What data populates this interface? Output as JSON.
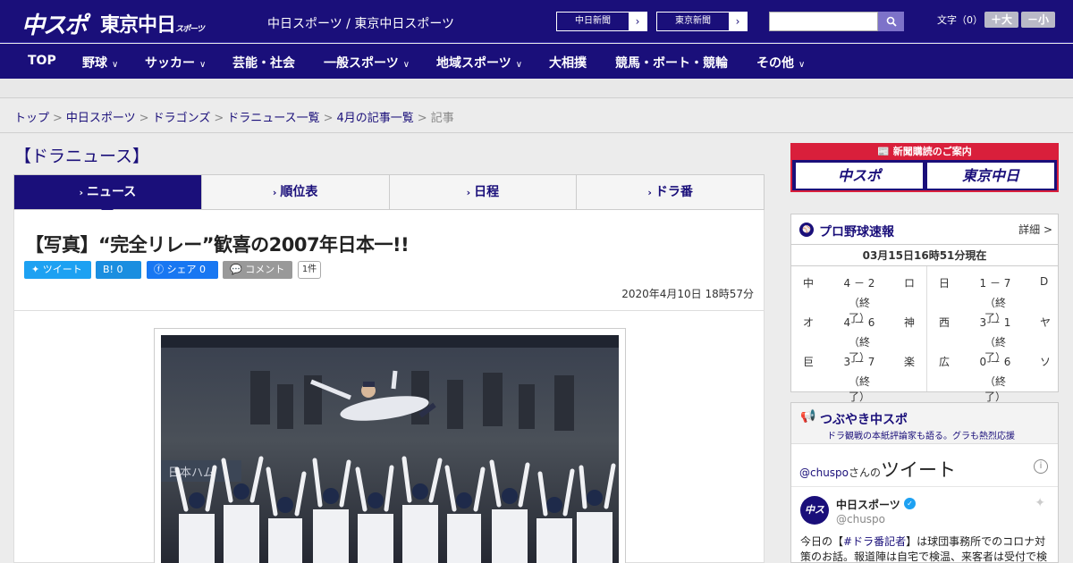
{
  "header": {
    "logo_chuspo": "中スポ",
    "logo_tokyo": "東京中日",
    "logo_tokyo_small": "スポーツ",
    "site_names": "中日スポーツ / 東京中日スポーツ",
    "ext_link_1": "中日新聞",
    "ext_link_2": "東京新聞",
    "search_placeholder": "",
    "fontsize_label": "文字（0）",
    "font_increase": "＋大",
    "font_decrease": "－小"
  },
  "nav": {
    "items": [
      {
        "label": "TOP",
        "has_menu": false
      },
      {
        "label": "野球",
        "has_menu": true
      },
      {
        "label": "サッカー",
        "has_menu": true
      },
      {
        "label": "芸能・社会",
        "has_menu": false
      },
      {
        "label": "一般スポーツ",
        "has_menu": true
      },
      {
        "label": "地域スポーツ",
        "has_menu": true
      },
      {
        "label": "大相撲",
        "has_menu": false
      },
      {
        "label": "競馬・ボート・競輪",
        "has_menu": false
      },
      {
        "label": "その他",
        "has_menu": true
      }
    ]
  },
  "breadcrumb": {
    "items": [
      "トップ",
      "中日スポーツ",
      "ドラゴンズ",
      "ドラニュース一覧",
      "4月の記事一覧"
    ],
    "current": "記事"
  },
  "section_title": "【ドラニュース】",
  "tabs": [
    {
      "label": "ニュース",
      "active": true
    },
    {
      "label": "順位表",
      "active": false
    },
    {
      "label": "日程",
      "active": false
    },
    {
      "label": "ドラ番",
      "active": false
    }
  ],
  "article": {
    "headline": "【写真】“完全リレー”歓喜の2007年日本一!!",
    "share": {
      "tweet": "ツイート",
      "hatena": "B! 0",
      "facebook": "シェア 0",
      "comment": "コメント",
      "count": "1件"
    },
    "date": "2020年4月10日 18時57分",
    "photo_sign": "日本ハム"
  },
  "sidebar": {
    "subscription": {
      "heading": "新聞購読のご案内",
      "logo_1": "中スポ",
      "logo_2": "東京中日"
    },
    "baseball": {
      "title": "プロ野球速報",
      "detail": "詳細 >",
      "timestamp": "03月15日16時51分現在",
      "games": [
        {
          "team1": "中",
          "score": "4 － 2",
          "team2": "ロ",
          "status": "（終了）"
        },
        {
          "team1": "日",
          "score": "1 － 7",
          "team2": "D",
          "status": "（終了）"
        },
        {
          "team1": "オ",
          "score": "4 － 6",
          "team2": "神",
          "status": "（終了）"
        },
        {
          "team1": "西",
          "score": "3 － 1",
          "team2": "ヤ",
          "status": "（終了）"
        },
        {
          "team1": "巨",
          "score": "3 － 7",
          "team2": "楽",
          "status": "（終了）"
        },
        {
          "team1": "広",
          "score": "0 － 6",
          "team2": "ソ",
          "status": "（終了）"
        }
      ]
    },
    "tweets": {
      "title": "つぶやき中スポ",
      "subtitle": "ドラ観戦の本紙評論家も語る。グラも熱烈応援",
      "handle": "@chuspo",
      "san_no": "さんの",
      "tweet_word": "ツイート",
      "account_name": "中日スポーツ",
      "account_handle": "@chuspo",
      "avatar_text": "中スポ",
      "text_pre": "今日の【",
      "text_tag": "#ドラ番記者",
      "text_post": "】は球団事務所でのコロナ対策のお話。報道陣は自宅で検温、来客者は受付で検"
    }
  },
  "colors": {
    "brand_navy": "#1a0f7a",
    "accent_red": "#d91f3b",
    "twitter_blue": "#1da1f2"
  }
}
